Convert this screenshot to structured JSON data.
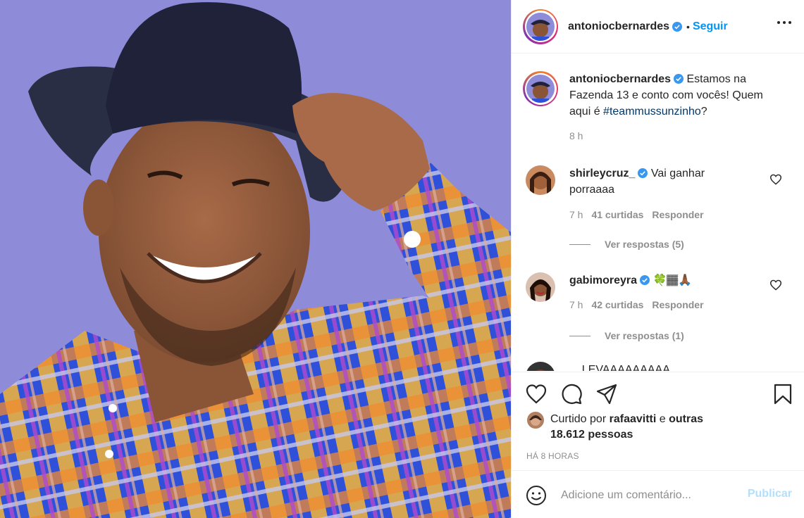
{
  "post": {
    "author": "antoniocbernardes",
    "follow_separator": "•",
    "follow_label": "Seguir",
    "caption_text": "Estamos na Fazenda 13 e conto com vocês! Quem aqui é",
    "caption_hashtag": "#teammussunzinho",
    "caption_end": "?",
    "caption_time": "8 h"
  },
  "comments": [
    {
      "user": "shirleycruz_",
      "text": "Vai ganhar porraaaa",
      "time": "7 h",
      "likes": "41 curtidas",
      "reply": "Responder",
      "view_replies": "Ver respostas (5)"
    },
    {
      "user": "gabimoreyra",
      "text": "🍀🏾🙏🏾",
      "time": "7 h",
      "likes": "42 curtidas",
      "reply": "Responder",
      "view_replies": "Ver respostas (1)"
    },
    {
      "user": "...",
      "text": "LEVAAAAAAAAA"
    }
  ],
  "likes": {
    "prefix": "Curtido por",
    "user": "rafaavitti",
    "connector": "e",
    "others": "outras 18.612 pessoas"
  },
  "posted_ago": "HÁ 8 HORAS",
  "add_comment": {
    "placeholder": "Adicione um comentário...",
    "publish_label": "Publicar"
  },
  "colors": {
    "link_blue": "#0095f6",
    "hashtag": "#00376b",
    "muted": "#8e8e8e",
    "publish_disabled": "#b2dffc",
    "background_photo": "#8e8bd8"
  },
  "icons": [
    "heart-icon",
    "comment-icon",
    "share-icon",
    "bookmark-icon",
    "more-icon",
    "verified-icon",
    "emoji-icon"
  ]
}
